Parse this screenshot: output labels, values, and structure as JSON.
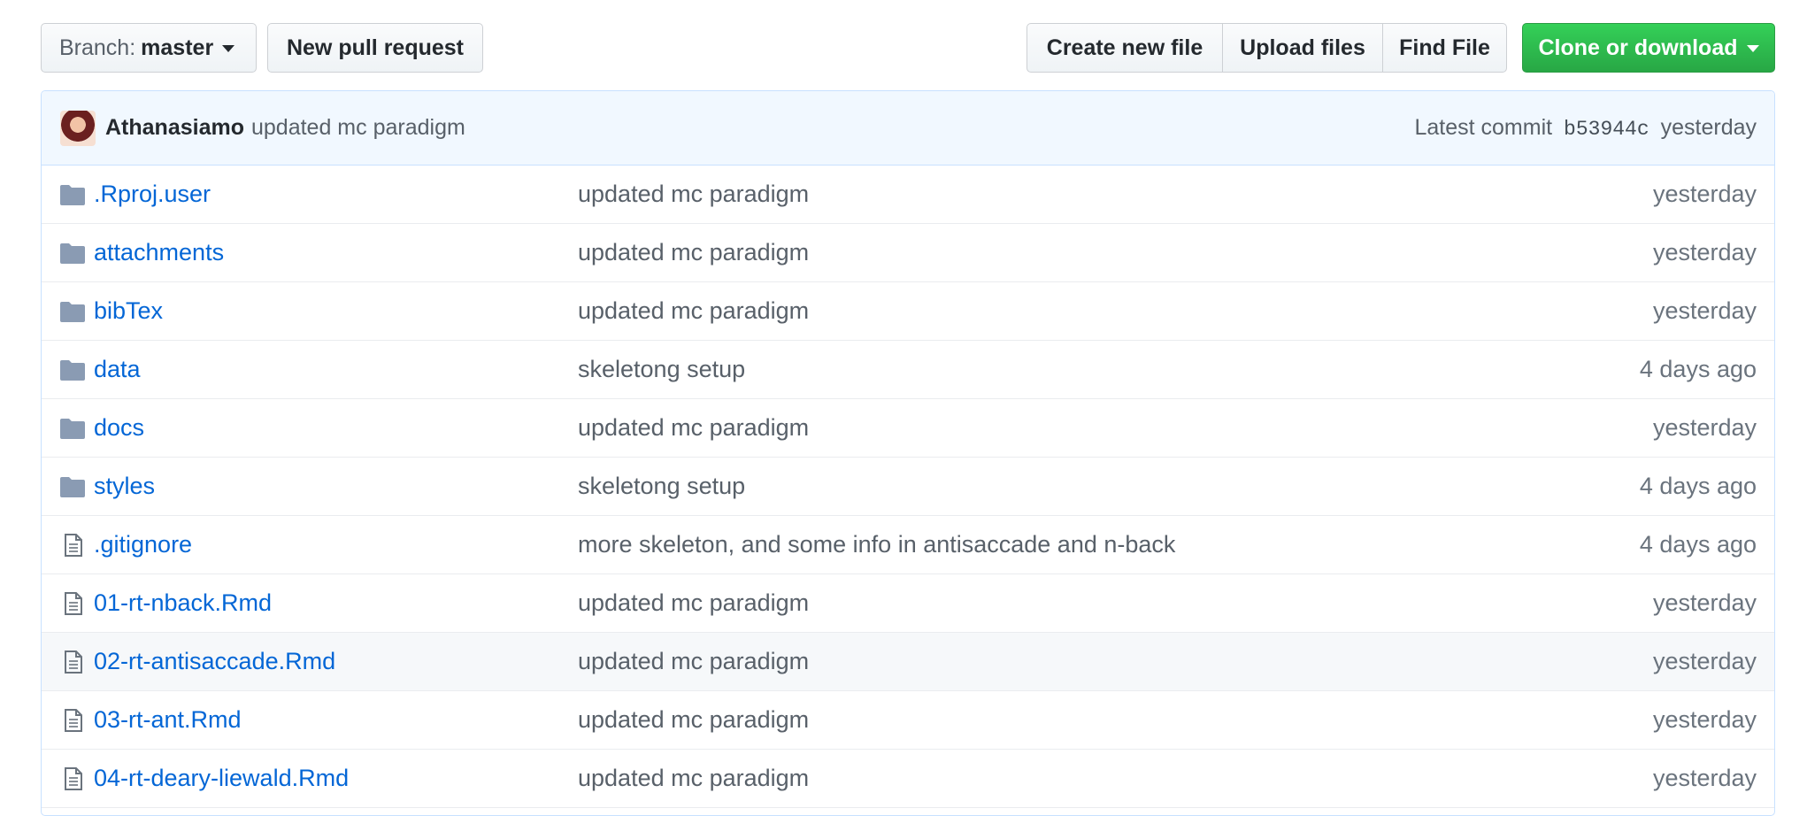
{
  "toolbar": {
    "branch_label": "Branch:",
    "branch_name": "master",
    "new_pr": "New pull request",
    "create_file": "Create new file",
    "upload_files": "Upload files",
    "find_file": "Find File",
    "clone": "Clone or download"
  },
  "commit": {
    "author": "Athanasiamo",
    "message": "updated mc paradigm",
    "latest_label": "Latest commit",
    "sha": "b53944c",
    "time": "yesterday"
  },
  "files": [
    {
      "name": ".Rproj.user",
      "type": "dir",
      "icon": "folder-icon",
      "message": "updated mc paradigm",
      "age": "yesterday"
    },
    {
      "name": "attachments",
      "type": "dir",
      "icon": "folder-icon",
      "message": "updated mc paradigm",
      "age": "yesterday"
    },
    {
      "name": "bibTex",
      "type": "dir",
      "icon": "folder-icon",
      "message": "updated mc paradigm",
      "age": "yesterday"
    },
    {
      "name": "data",
      "type": "dir",
      "icon": "folder-icon",
      "message": "skeletong setup",
      "age": "4 days ago"
    },
    {
      "name": "docs",
      "type": "dir",
      "icon": "folder-icon",
      "message": "updated mc paradigm",
      "age": "yesterday"
    },
    {
      "name": "styles",
      "type": "dir",
      "icon": "folder-icon",
      "message": "skeletong setup",
      "age": "4 days ago"
    },
    {
      "name": ".gitignore",
      "type": "file",
      "icon": "file-icon",
      "message": "more skeleton, and some info in antisaccade and n-back",
      "age": "4 days ago"
    },
    {
      "name": "01-rt-nback.Rmd",
      "type": "file",
      "icon": "file-icon",
      "message": "updated mc paradigm",
      "age": "yesterday"
    },
    {
      "name": "02-rt-antisaccade.Rmd",
      "type": "file",
      "icon": "file-icon",
      "message": "updated mc paradigm",
      "age": "yesterday",
      "hovered": true
    },
    {
      "name": "03-rt-ant.Rmd",
      "type": "file",
      "icon": "file-icon",
      "message": "updated mc paradigm",
      "age": "yesterday"
    },
    {
      "name": "04-rt-deary-liewald.Rmd",
      "type": "file",
      "icon": "file-icon",
      "message": "updated mc paradigm",
      "age": "yesterday"
    }
  ],
  "colors": {
    "link": "#0366d6",
    "folder": "#79b8ff",
    "clone_green": "#28a745",
    "commit_bar": "#f1f8ff"
  }
}
